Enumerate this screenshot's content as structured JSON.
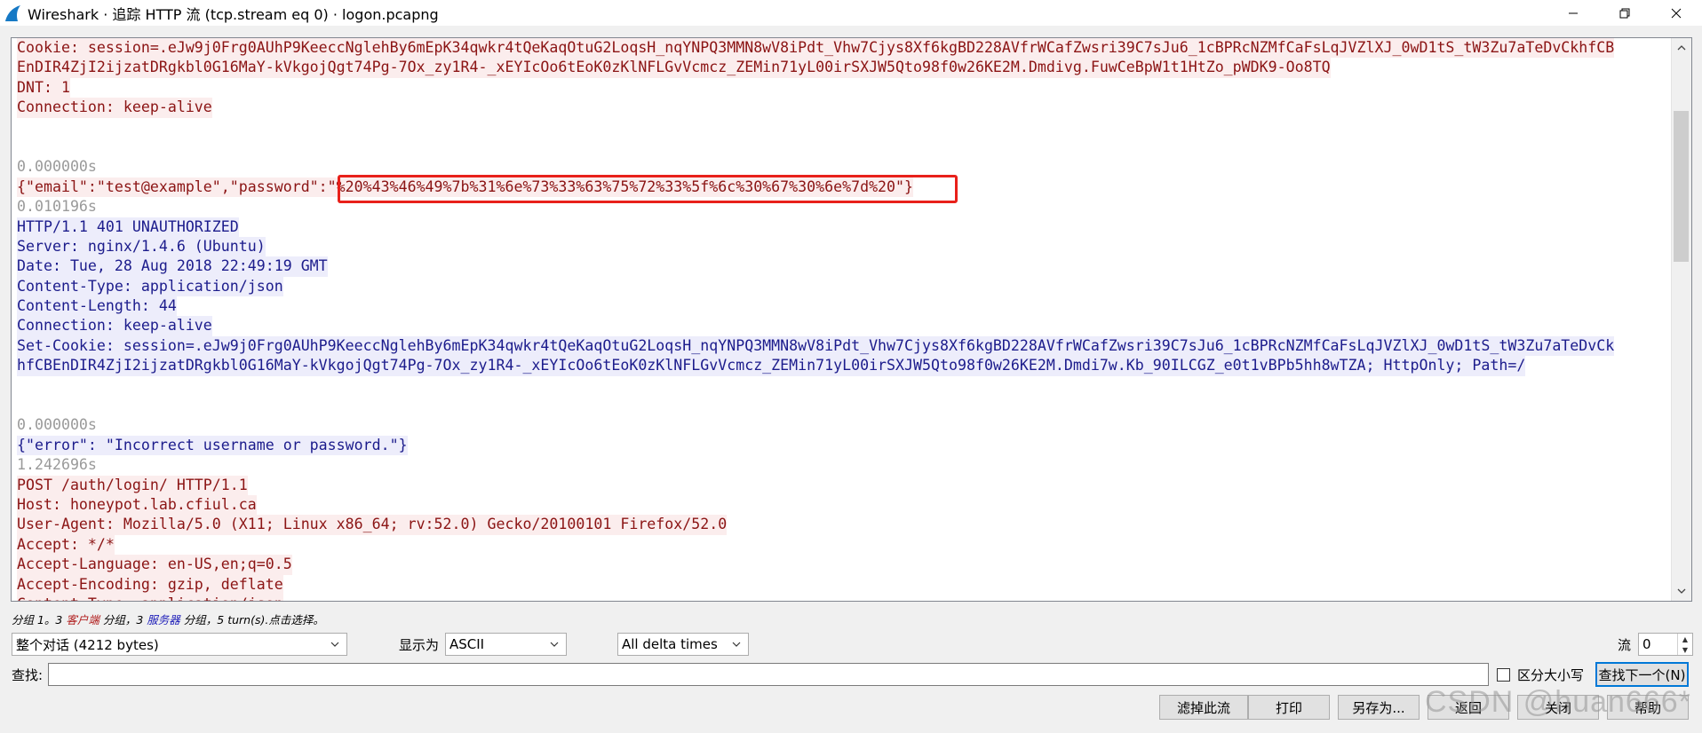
{
  "window": {
    "title": "Wireshark · 追踪 HTTP 流 (tcp.stream eq 0) · logon.pcapng"
  },
  "stream": {
    "lines": [
      {
        "segments": [
          {
            "text": "Cookie: session=.eJw9j0Frg0AUhP9KeeccNglehBy6mEpK34qwkr4tQeKaqOtuG2LoqsH_nqYNPQ3MMN8wV8iPdt_Vhw7Cjys8Xf6kgBD228AVfrWCafZwsri39C7sJu6_1cBPRcNZMfCaFsLqJVZlXJ_0wD1tS_tW3Zu7aTeDvCkhfCB",
            "cls": "client"
          }
        ]
      },
      {
        "segments": [
          {
            "text": "EnDIR4ZjI2ijzatDRgkbl0G16MaY-kVkgojQgt74Pg-7Ox_zy1R4-_xEYIcOo6tEoK0zKlNFLGvVcmcz_ZEMin71yL00irSXJW5Qto98f0w26KE2M.Dmdivg.FuwCeBpW1t1HtZo_pWDK9-Oo8TQ",
            "cls": "client"
          }
        ]
      },
      {
        "segments": [
          {
            "text": "DNT: 1",
            "cls": "client"
          }
        ]
      },
      {
        "segments": [
          {
            "text": "Connection: keep-alive",
            "cls": "client"
          }
        ]
      },
      {
        "segments": []
      },
      {
        "segments": []
      },
      {
        "segments": [
          {
            "text": "0.000000s",
            "cls": "ts"
          }
        ]
      },
      {
        "segments": [
          {
            "text": "{\"email\":\"test@example\",\"password\":\"%20%43%46%49%7b%31%6e%73%33%63%75%72%33%5f%6c%30%67%30%6e%7d%20\"}",
            "cls": "client"
          }
        ]
      },
      {
        "segments": [
          {
            "text": "0.010196s",
            "cls": "ts"
          }
        ]
      },
      {
        "segments": [
          {
            "text": "HTTP/1.1 401 UNAUTHORIZED",
            "cls": "server"
          }
        ]
      },
      {
        "segments": [
          {
            "text": "Server: nginx/1.4.6 (Ubuntu)",
            "cls": "server"
          }
        ]
      },
      {
        "segments": [
          {
            "text": "Date: Tue, 28 Aug 2018 22:49:19 GMT",
            "cls": "server"
          }
        ]
      },
      {
        "segments": [
          {
            "text": "Content-Type: application/json",
            "cls": "server"
          }
        ]
      },
      {
        "segments": [
          {
            "text": "Content-Length: 44",
            "cls": "server"
          }
        ]
      },
      {
        "segments": [
          {
            "text": "Connection: keep-alive",
            "cls": "server"
          }
        ]
      },
      {
        "segments": [
          {
            "text": "Set-Cookie: session=.eJw9j0Frg0AUhP9KeeccNglehBy6mEpK34qwkr4tQeKaqOtuG2LoqsH_nqYNPQ3MMN8wV8iPdt_Vhw7Cjys8Xf6kgBD228AVfrWCafZwsri39C7sJu6_1cBPRcNZMfCaFsLqJVZlXJ_0wD1tS_tW3Zu7aTeDvCk",
            "cls": "server"
          }
        ]
      },
      {
        "segments": [
          {
            "text": "hfCBEnDIR4ZjI2ijzatDRgkbl0G16MaY-kVkgojQgt74Pg-7Ox_zy1R4-_xEYIcOo6tEoK0zKlNFLGvVcmcz_ZEMin71yL00irSXJW5Qto98f0w26KE2M.Dmdi7w.Kb_90ILCGZ_e0t1vBPb5hh8wTZA; HttpOnly; Path=/",
            "cls": "server"
          }
        ]
      },
      {
        "segments": []
      },
      {
        "segments": []
      },
      {
        "segments": [
          {
            "text": "0.000000s",
            "cls": "ts"
          }
        ]
      },
      {
        "segments": [
          {
            "text": "{\"error\": \"Incorrect username or password.\"}",
            "cls": "server"
          }
        ]
      },
      {
        "segments": [
          {
            "text": "1.242696s",
            "cls": "ts"
          }
        ]
      },
      {
        "segments": [
          {
            "text": "POST /auth/login/ HTTP/1.1",
            "cls": "client"
          }
        ]
      },
      {
        "segments": [
          {
            "text": "Host: honeypot.lab.cfiul.ca",
            "cls": "client"
          }
        ]
      },
      {
        "segments": [
          {
            "text": "User-Agent: Mozilla/5.0 (X11; Linux x86_64; rv:52.0) Gecko/20100101 Firefox/52.0",
            "cls": "client"
          }
        ]
      },
      {
        "segments": [
          {
            "text": "Accept: */*",
            "cls": "client"
          }
        ]
      },
      {
        "segments": [
          {
            "text": "Accept-Language: en-US,en;q=0.5",
            "cls": "client"
          }
        ]
      },
      {
        "segments": [
          {
            "text": "Accept-Encoding: gzip, deflate",
            "cls": "client"
          }
        ]
      },
      {
        "segments": [
          {
            "text": "Content-Type: application/json",
            "cls": "client"
          }
        ]
      }
    ]
  },
  "status": {
    "prefix": "分组 1。3 ",
    "client_label": "客户端",
    "middle": " 分组，3 ",
    "server_label": "服务器",
    "suffix": " 分组，5 turn(s).点击选择。"
  },
  "controls": {
    "conversation_select": "整个对话 (4212 bytes)",
    "show_as_label": "显示为",
    "show_as_value": "ASCII",
    "delta_select": "All delta times",
    "stream_label": "流",
    "stream_value": "0"
  },
  "find": {
    "label": "查找:",
    "value": "",
    "case_label": "区分大小写",
    "find_next_button": "查找下一个(N)"
  },
  "buttons": {
    "filter_out": "滤掉此流",
    "print": "打印",
    "save_as": "另存为...",
    "back": "返回",
    "close": "关闭",
    "help": "帮助"
  },
  "watermark": "CSDN @huan666*",
  "colors": {
    "client_text": "#8b1414",
    "client_bg": "#fbeded",
    "server_text": "#1c1c8c",
    "server_bg": "#ededfb",
    "highlight_box": "#e8201a"
  }
}
